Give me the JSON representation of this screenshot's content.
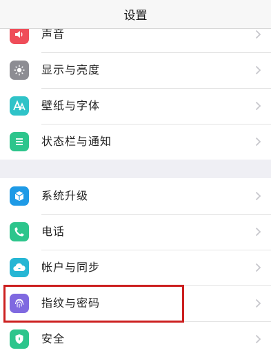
{
  "header": {
    "title": "设置"
  },
  "group1": [
    {
      "label": "声音",
      "icon": "speaker-icon",
      "color": "#ef4d59"
    },
    {
      "label": "显示与亮度",
      "icon": "sun-icon",
      "color": "#8d8d93"
    },
    {
      "label": "壁纸与字体",
      "icon": "letter-a-icon",
      "color": "#2fc3c8"
    },
    {
      "label": "状态栏与通知",
      "icon": "list-icon",
      "color": "#2dc58c"
    }
  ],
  "group2": [
    {
      "label": "系统升级",
      "icon": "package-icon",
      "color": "#1e9ae6"
    },
    {
      "label": "电话",
      "icon": "phone-icon",
      "color": "#2dc58c"
    },
    {
      "label": "帐户与同步",
      "icon": "cloud-icon",
      "color": "#26b6d4"
    },
    {
      "label": "指纹与密码",
      "icon": "fingerprint-icon",
      "color": "#7f69e0"
    },
    {
      "label": "安全",
      "icon": "shield-icon",
      "color": "#2dc58c"
    }
  ],
  "annotation": {
    "highlight_color": "#cc1f1f",
    "highlighted_item": "指纹与密码"
  }
}
